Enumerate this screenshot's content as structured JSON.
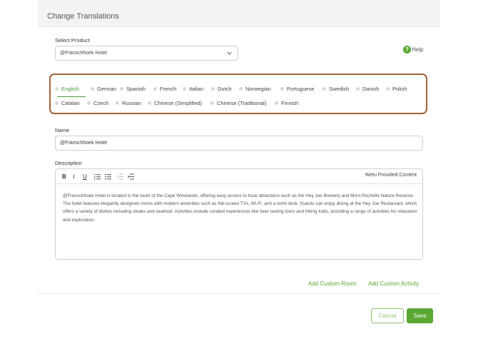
{
  "modal": {
    "title": "Change Translations"
  },
  "product": {
    "label": "Select Product",
    "value": "@Franschhoek Hotel"
  },
  "help": {
    "label": "Help"
  },
  "languages": {
    "active": "English",
    "row1": [
      "English",
      "German",
      "Spanish",
      "French",
      "Italian",
      "Dutch",
      "Norwegian",
      "Portuguese",
      "Swedish",
      "Danish",
      "Polish"
    ],
    "row2": [
      "Catalan",
      "Czech",
      "Russian",
      "Chinese (Simplified)",
      "Chinese (Traditional)",
      "Finnish"
    ]
  },
  "name": {
    "label": "Name",
    "value": "@Franschhoek Hotel"
  },
  "description": {
    "label": "Description",
    "toolbar": {
      "bold": "B",
      "italic": "I",
      "underline": "U"
    },
    "source_label": "Wetu Provided Content",
    "text": "@Franschhoek Hotel is located in the heart of the Cape Winelands, offering easy access to local attractions such as the Hey Joe Brewery and Mont Rochelle Nature Reserve. The hotel features elegantly designed rooms with modern amenities such as flat-screen TVs, Wi-Fi, and a work desk. Guests can enjoy dining at the Hey Joe Restaurant, which offers a variety of dishes including steaks and seafood. Activities include curated experiences like beer tasting tours and hiking trails, providing a range of activities for relaxation and exploration."
  },
  "actions": {
    "add_room": "Add Custom Room",
    "add_activity": "Add Custom Activity",
    "cancel": "Cancel",
    "save": "Save"
  },
  "colors": {
    "accent": "#5aa832",
    "highlight_border": "#a0623b"
  }
}
